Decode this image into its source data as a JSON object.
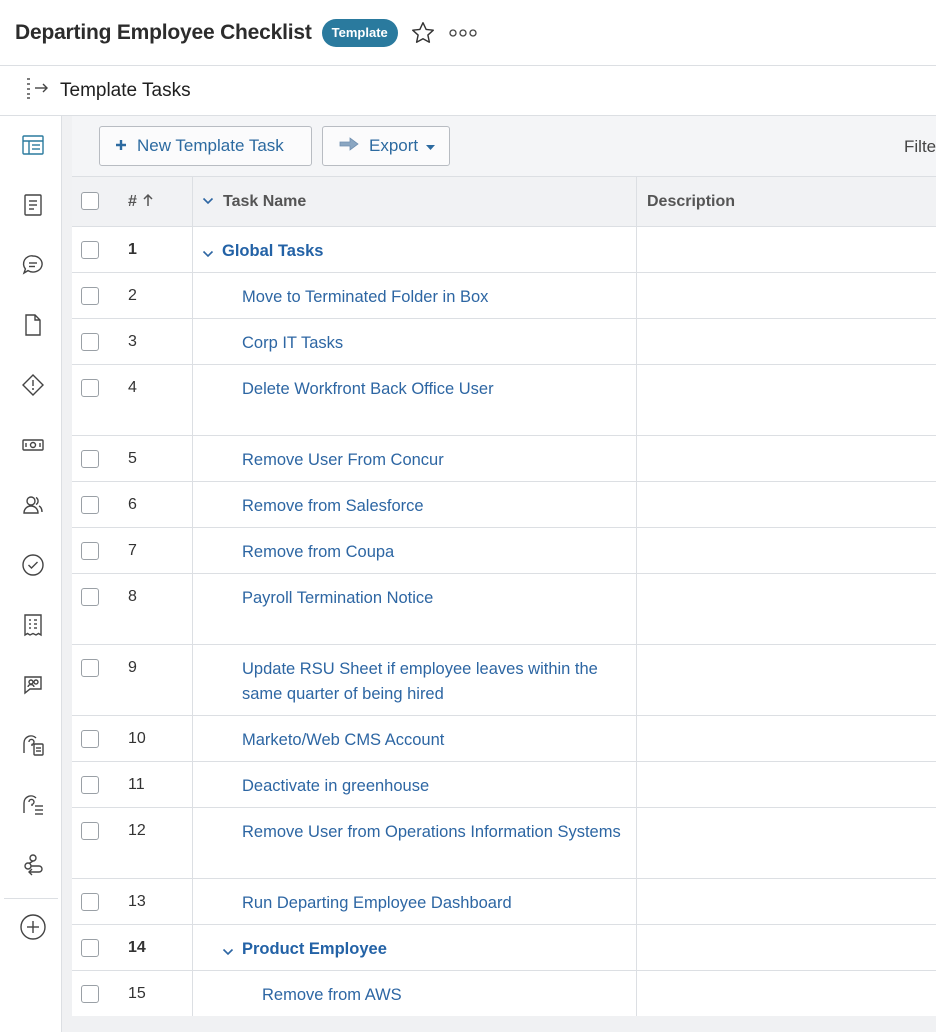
{
  "header": {
    "title": "Departing Employee Checklist",
    "badge": "Template"
  },
  "subheader": {
    "title": "Template Tasks"
  },
  "toolbar": {
    "new_task_label": "New Template Task",
    "export_label": "Export",
    "filter_label": "Filte"
  },
  "table": {
    "columns": {
      "number": "#",
      "task_name": "Task Name",
      "description": "Description"
    },
    "rows": [
      {
        "num": "1",
        "name": "Global Tasks",
        "group": true,
        "indent": 0
      },
      {
        "num": "2",
        "name": "Move to Terminated Folder in Box",
        "group": false,
        "indent": 1
      },
      {
        "num": "3",
        "name": "Corp IT Tasks",
        "group": false,
        "indent": 1
      },
      {
        "num": "4",
        "name": "Delete Workfront Back Office User",
        "group": false,
        "indent": 1
      },
      {
        "num": "5",
        "name": "Remove User From Concur",
        "group": false,
        "indent": 1
      },
      {
        "num": "6",
        "name": "Remove from Salesforce",
        "group": false,
        "indent": 1
      },
      {
        "num": "7",
        "name": "Remove from Coupa",
        "group": false,
        "indent": 1
      },
      {
        "num": "8",
        "name": "Payroll Termination Notice",
        "group": false,
        "indent": 1
      },
      {
        "num": "9",
        "name": "Update RSU Sheet if employee leaves within the same quarter of being hired",
        "group": false,
        "indent": 1
      },
      {
        "num": "10",
        "name": "Marketo/Web CMS Account",
        "group": false,
        "indent": 1
      },
      {
        "num": "11",
        "name": "Deactivate in greenhouse",
        "group": false,
        "indent": 1
      },
      {
        "num": "12",
        "name": "Remove User from Operations Information Systems",
        "group": false,
        "indent": 1
      },
      {
        "num": "13",
        "name": "Run Departing Employee Dashboard",
        "group": false,
        "indent": 1
      },
      {
        "num": "14",
        "name": "Product Employee",
        "group": true,
        "indent": 1
      },
      {
        "num": "15",
        "name": "Remove from AWS",
        "group": false,
        "indent": 2
      }
    ]
  },
  "leftnav": {
    "icons": [
      "task-list-icon",
      "document-icon",
      "comment-icon",
      "file-icon",
      "issue-icon",
      "expense-icon",
      "people-icon",
      "approval-icon",
      "receipt-icon",
      "chat-people-icon",
      "request-doc-icon",
      "request-list-icon",
      "workflow-icon",
      "add-icon"
    ]
  },
  "colors": {
    "link": "#2d66a3",
    "badge": "#2a7a9e",
    "active_icon": "#2a7a9e"
  }
}
